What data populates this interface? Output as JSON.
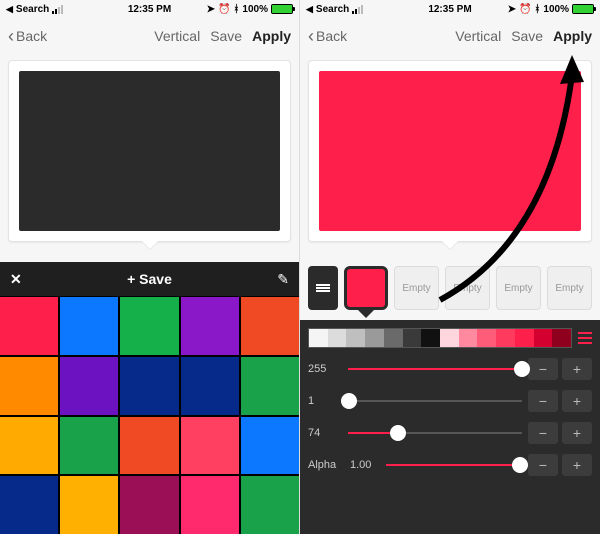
{
  "status": {
    "back_app": "Search",
    "time": "12:35 PM",
    "battery_pct": "100%",
    "bt_icon": "bluetooth",
    "loc_icon": "location",
    "alarm_icon": "alarm"
  },
  "nav": {
    "back": "Back",
    "vertical": "Vertical",
    "save": "Save",
    "apply": "Apply"
  },
  "left": {
    "preview_color": "#2b2b2b",
    "palette_bar": {
      "save": "+ Save",
      "close": "✕",
      "edit": "✎"
    },
    "swatches": [
      "#ff1f4b",
      "#0b78ff",
      "#15b04a",
      "#8a18c9",
      "#ef4a24",
      "#ff8a00",
      "#6d12c0",
      "#062a8a",
      "#062a8a",
      "#1aa24a",
      "#ffaa00",
      "#1aa24a",
      "#ef4a24",
      "#ff4060",
      "#0b78ff",
      "#062a8a",
      "#ffb000",
      "#9b0f57",
      "#ff2a6d",
      "#1aa24a"
    ]
  },
  "right": {
    "preview_color": "#ff1f4b",
    "current_chip": "#ff1f4b",
    "empty_label": "Empty",
    "spectrum": [
      "#f5f5f5",
      "#dcdcdc",
      "#bfbfbf",
      "#9a9a9a",
      "#6a6a6a",
      "#3a3a3a",
      "#111111",
      "#ffd6de",
      "#ff8aa0",
      "#ff5c7a",
      "#ff3a5f",
      "#ff1f4b",
      "#d4002f",
      "#8f001f"
    ],
    "sliders": {
      "r": {
        "label": "255",
        "value": 255,
        "max": 255
      },
      "g": {
        "label": "1",
        "value": 1,
        "max": 255
      },
      "b": {
        "label": "74",
        "value": 74,
        "max": 255
      }
    },
    "alpha": {
      "label": "Alpha",
      "value": "1.00",
      "num": 1.0
    },
    "pm": {
      "minus": "−",
      "plus": "+"
    }
  }
}
